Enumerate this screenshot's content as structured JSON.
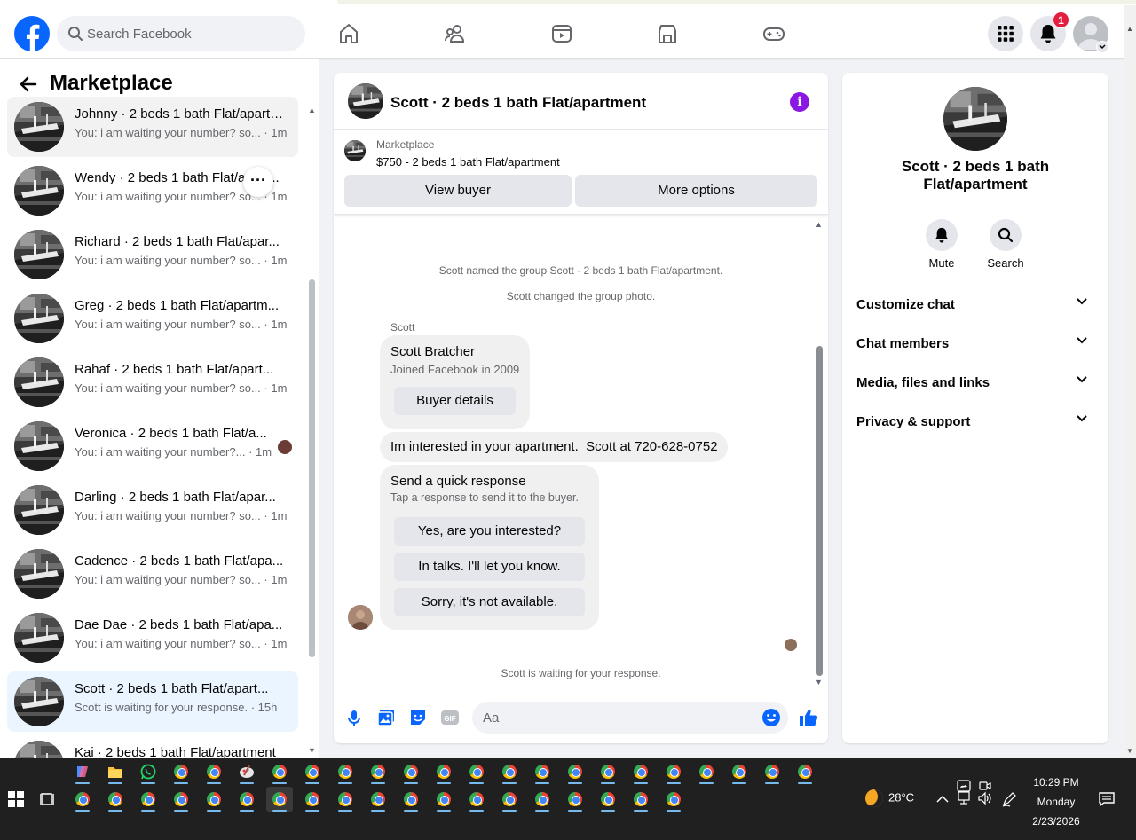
{
  "topnav": {
    "search_placeholder": "Search Facebook",
    "notification_count": "1",
    "nav_icons": [
      "home-icon",
      "friends-icon",
      "video-icon",
      "marketplace-icon",
      "gaming-icon"
    ]
  },
  "sidebar": {
    "title": "Marketplace",
    "conversations": [
      {
        "name": "Johnny · 2 beds 1 bath Flat/apartment",
        "preview": "You: i am waiting your number? so... · 1m"
      },
      {
        "name": "Wendy · 2 beds 1 bath Flat/apart...",
        "preview": "You: i am waiting your number? so... · 1m"
      },
      {
        "name": "Richard · 2 beds 1 bath Flat/apar...",
        "preview": "You: i am waiting your number? so... · 1m"
      },
      {
        "name": "Greg · 2 beds 1 bath Flat/apartm...",
        "preview": "You: i am waiting your number? so... · 1m"
      },
      {
        "name": "Rahaf · 2 beds 1 bath Flat/apart...",
        "preview": "You: i am waiting your number? so... · 1m"
      },
      {
        "name": "Veronica · 2 beds 1 bath Flat/a...",
        "preview": "You: i am waiting your number?... · 1m"
      },
      {
        "name": "Darling · 2 beds 1 bath Flat/apar...",
        "preview": "You: i am waiting your number? so... · 1m"
      },
      {
        "name": "Cadence · 2 beds 1 bath Flat/apa...",
        "preview": "You: i am waiting your number? so... · 1m"
      },
      {
        "name": "Dae Dae · 2 beds 1 bath Flat/apa...",
        "preview": "You: i am waiting your number? so... · 1m"
      },
      {
        "name": "Scott · 2 beds 1 bath Flat/apart...",
        "preview": "Scott is waiting for your response. · 15h"
      },
      {
        "name": "Kai · 2 beds 1 bath Flat/apartment",
        "preview": ""
      }
    ]
  },
  "chat": {
    "title": "Scott · 2 beds 1 bath Flat/apartment",
    "listing_source": "Marketplace",
    "listing_desc": "$750 - 2 beds 1 bath Flat/apartment",
    "view_buyer": "View buyer",
    "more_options": "More options",
    "system_1": "Scott named the group Scott · 2 beds 1 bath Flat/apartment.",
    "system_2": "Scott changed the group photo.",
    "sender": "Scott",
    "card_name": "Scott Bratcher",
    "card_sub": "Joined Facebook in 2009",
    "card_button": "Buyer details",
    "message": "Im interested in your apartment.  Scott at 720-628-0752",
    "quick_title": "Send a quick response",
    "quick_sub": "Tap a response to send it to the buyer.",
    "quick_options": [
      "Yes, are you interested?",
      "In talks. I'll let you know.",
      "Sorry, it's not available."
    ],
    "waiting": "Scott is waiting for your response.",
    "composer_placeholder": "Aa"
  },
  "info_panel": {
    "name": "Scott · 2 beds 1 bath Flat/apartment",
    "mute": "Mute",
    "search": "Search",
    "sections": [
      "Customize chat",
      "Chat members",
      "Media, files and links",
      "Privacy & support"
    ]
  },
  "taskbar": {
    "temperature": "28°C",
    "time": "10:29 PM",
    "day": "Monday",
    "date": "2/23/2026"
  },
  "colors": {
    "brand_blue": "#0866ff",
    "badge_red": "#e41e3f",
    "info_purple": "#8a17e3",
    "active_row": "#ebf5ff"
  }
}
